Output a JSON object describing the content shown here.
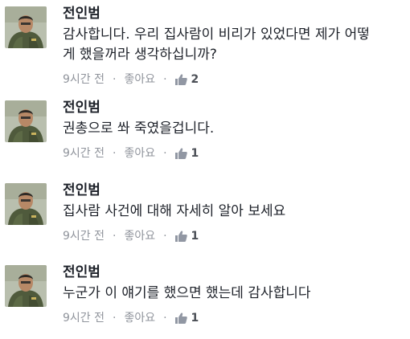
{
  "comments": [
    {
      "author": "전인범",
      "text": "감사합니다. 우리 집사람이 비리가 있었다면 제가 어떻\n게 했을꺼라 생각하십니까?",
      "time": "9시간 전",
      "like_label": "좋아요",
      "like_count": "2"
    },
    {
      "author": "전인범",
      "text": "권총으로 쏴 죽였을겁니다.",
      "time": "9시간 전",
      "like_label": "좋아요",
      "like_count": "1"
    },
    {
      "author": "전인범",
      "text": "집사람 사건에 대해 자세히 알아 보세요",
      "time": "9시간 전",
      "like_label": "좋아요",
      "like_count": "1"
    },
    {
      "author": "전인범",
      "text": "누군가 이 얘기를 했으면 했는데 감사합니다",
      "time": "9시간 전",
      "like_label": "좋아요",
      "like_count": "1"
    }
  ],
  "colors": {
    "author_text": "#1d2129",
    "meta_text": "#90949c",
    "like_icon": "#9197a3",
    "background": "#ffffff"
  },
  "icons": {
    "avatar": "avatar-photo",
    "like": "thumbs-up-icon",
    "separator": "middle-dot"
  }
}
